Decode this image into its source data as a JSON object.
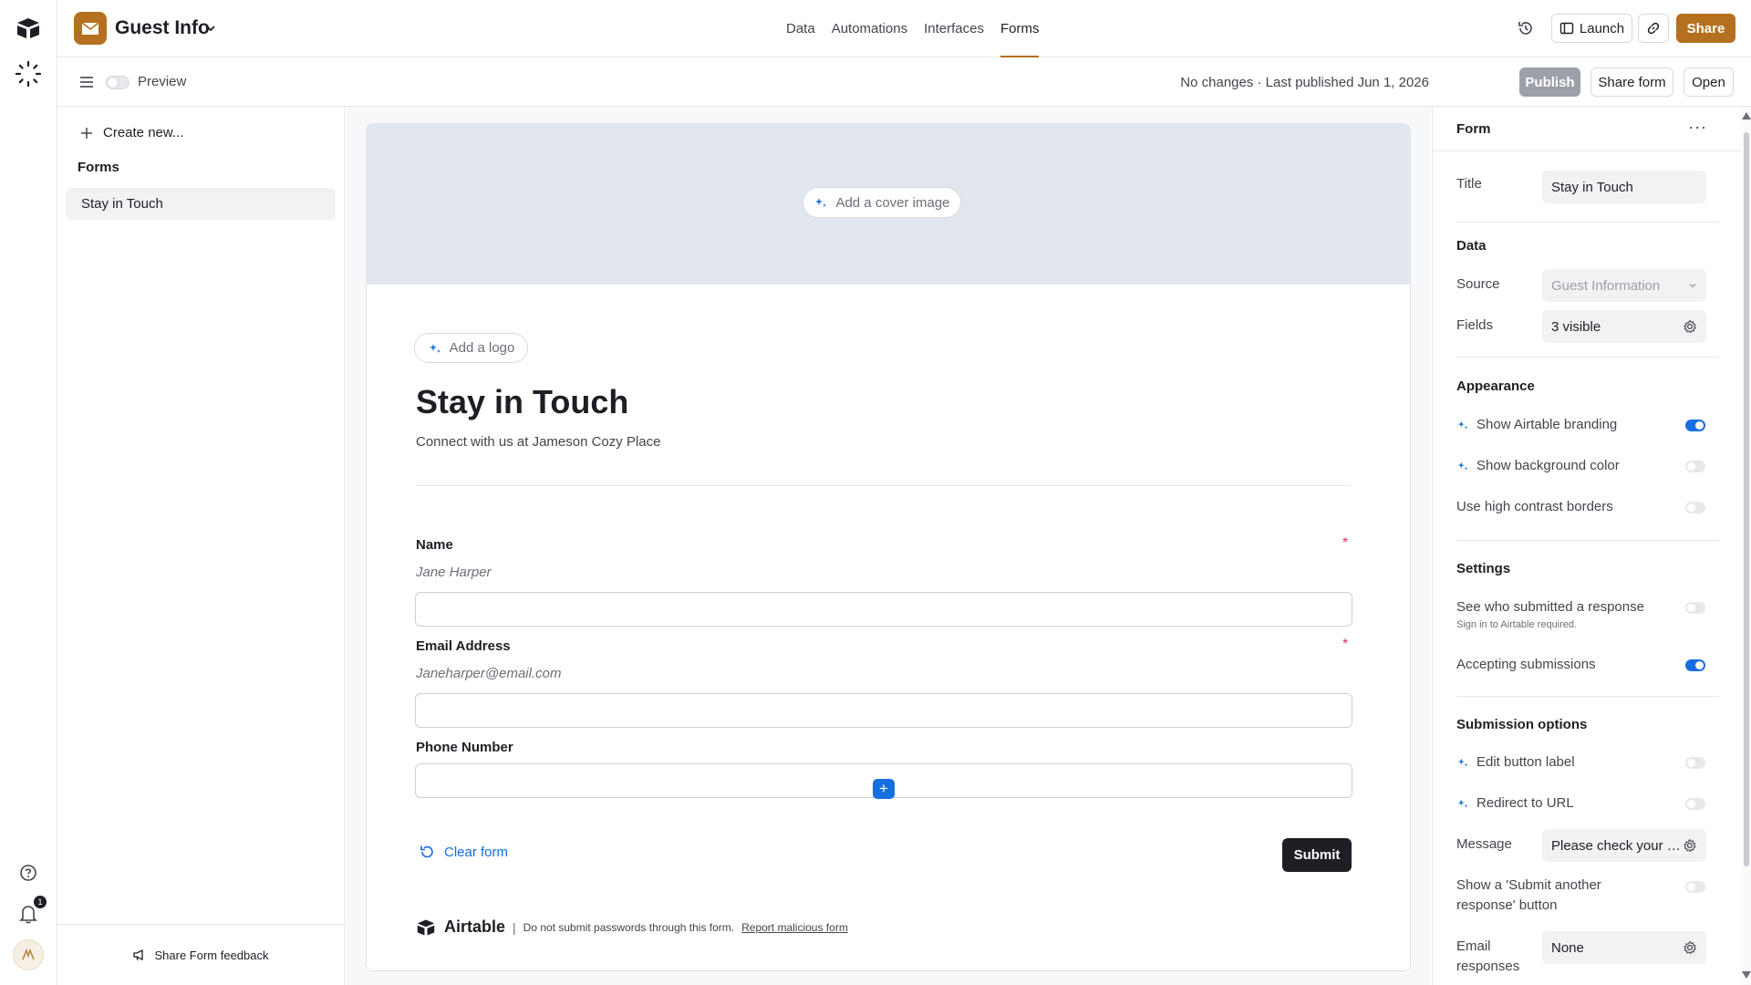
{
  "app": {
    "base_name": "Guest Info",
    "nav_tabs": [
      {
        "label": "Data"
      },
      {
        "label": "Automations"
      },
      {
        "label": "Interfaces"
      },
      {
        "label": "Forms"
      }
    ],
    "active_tab": "Forms",
    "launch_label": "Launch",
    "share_label": "Share",
    "brand_color": "#b4701e",
    "notification_count": "1"
  },
  "subbar": {
    "preview_label": "Preview",
    "status": "No changes · Last published Jun 1, 2026",
    "publish_label": "Publish",
    "share_form_label": "Share form",
    "open_label": "Open"
  },
  "left_panel": {
    "create_new": "Create new...",
    "forms_heading": "Forms",
    "forms": [
      {
        "label": "Stay in Touch"
      }
    ],
    "feedback_label": "Share Form feedback"
  },
  "form": {
    "cover_button": "Add a cover image",
    "logo_button": "Add a logo",
    "title": "Stay in Touch",
    "description": "Connect with us at Jameson Cozy Place",
    "fields": [
      {
        "label": "Name",
        "hint": "Jane Harper",
        "required": "*"
      },
      {
        "label": "Email Address",
        "hint": "Janeharper@email.com",
        "required": "*"
      },
      {
        "label": "Phone Number",
        "hint": "",
        "required": ""
      }
    ],
    "clear_label": "Clear form",
    "submit_label": "Submit",
    "footer_brand": "Airtable",
    "footer_sep": "|",
    "footer_note": "Do not submit passwords through this form.",
    "footer_link": "Report malicious form"
  },
  "right_panel": {
    "header": "Form",
    "more_label": "···",
    "title_label": "Title",
    "title_value": "Stay in Touch",
    "data_section": "Data",
    "source_label": "Source",
    "source_value": "Guest Information",
    "fields_label": "Fields",
    "fields_value": "3 visible",
    "appearance_section": "Appearance",
    "show_branding": {
      "label": "Show Airtable branding",
      "on": true
    },
    "show_bg": {
      "label": "Show background color",
      "on": false
    },
    "high_contrast": {
      "label": "Use high contrast borders",
      "on": false
    },
    "settings_section": "Settings",
    "see_who": {
      "label": "See who submitted a response",
      "note": "Sign in to Airtable required.",
      "on": false
    },
    "accepting": {
      "label": "Accepting submissions",
      "on": true
    },
    "submission_section": "Submission options",
    "edit_button_label": {
      "label": "Edit button label",
      "on": false
    },
    "redirect": {
      "label": "Redirect to URL",
      "on": false
    },
    "message_label": "Message",
    "message_value": "Please check your e...",
    "submit_another": {
      "label": "Show a 'Submit another response' button",
      "on": false
    },
    "email_label": "Email responses",
    "email_value": "None"
  }
}
